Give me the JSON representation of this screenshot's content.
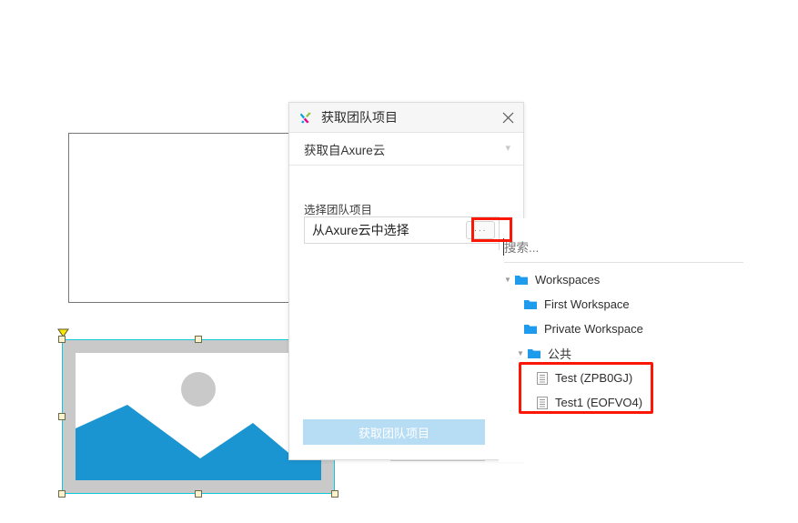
{
  "dialog": {
    "title": "获取团队项目",
    "logo_icon": "axure-logo-icon",
    "close_icon": "close-icon",
    "source_select": {
      "value": "获取自Axure云",
      "chevron_icon": "chevron-down-icon"
    },
    "field_label": "选择团队项目",
    "path_input": {
      "value": "从Axure云中选择",
      "placeholder": "从Axure云中选择"
    },
    "browse_button": {
      "label": "···",
      "icon": "ellipsis-icon"
    },
    "primary_button": {
      "label": "获取团队项目",
      "disabled_color": "#b7ddf5"
    }
  },
  "popup": {
    "search": {
      "placeholder": "搜索...",
      "value": ""
    },
    "tree": [
      {
        "label": "Workspaces",
        "icon": "folder-icon",
        "level": 1,
        "expanded": true,
        "twisty": "▼"
      },
      {
        "label": "First Workspace",
        "icon": "folder-icon",
        "level": 2,
        "expanded": false,
        "twisty": ""
      },
      {
        "label": "Private Workspace",
        "icon": "folder-icon",
        "level": 2,
        "expanded": false,
        "twisty": ""
      },
      {
        "label": "公共",
        "icon": "folder-icon",
        "level": 1,
        "expanded": true,
        "twisty": "▼"
      },
      {
        "label": "Test (ZPB0GJ)",
        "icon": "document-icon",
        "level": 3,
        "expanded": false,
        "twisty": ""
      },
      {
        "label": "Test1 (EOFVO4)",
        "icon": "document-icon",
        "level": 3,
        "expanded": false,
        "twisty": ""
      }
    ]
  },
  "annotations": {
    "highlight_color": "#fb1705",
    "boxes": [
      {
        "name": "browse-button-highlight"
      },
      {
        "name": "team-projects-highlight"
      }
    ]
  },
  "canvas": {
    "empty_rectangle": {
      "name": "empty-rectangle-widget"
    },
    "image_widget": {
      "name": "image-placeholder-widget",
      "frame_color": "#c9c9c9",
      "art_color": "#1b95d2",
      "sun_color": "#c9c9c9",
      "selected": true,
      "selection_color": "#12c8d8",
      "handle_fill": "#fdf2cf"
    }
  }
}
